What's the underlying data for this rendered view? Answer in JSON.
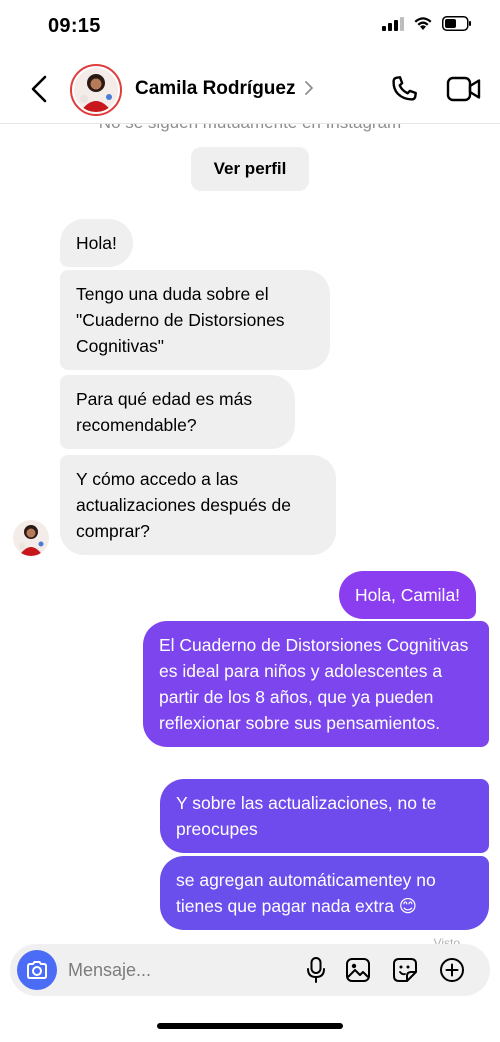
{
  "status_bar": {
    "time": "09:15"
  },
  "header": {
    "contact_name": "Camila Rodríguez"
  },
  "chat": {
    "faded_notice": "No se siguen mutuamente en Instagram",
    "view_profile_label": "Ver perfil",
    "incoming": [
      "Hola!",
      "Tengo una duda sobre el \"Cuaderno de Distorsiones Cognitivas\"",
      "Para qué edad es más recomendable?",
      "Y cómo accedo a las actualizaciones después de comprar?"
    ],
    "outgoing": [
      "Hola, Camila!",
      "El Cuaderno de Distorsiones Cognitivas es ideal para niños y adolescentes a partir de los 8 años, que ya pueden reflexionar sobre sus pensamientos.",
      "Y sobre las actualizaciones, no te preocupes",
      "se agregan automáticamentey no tienes que pagar nada extra 😊"
    ],
    "seen_label": "Visto"
  },
  "composer": {
    "placeholder": "Mensaje..."
  },
  "colors": {
    "accent_blue": "#4a6cf7",
    "bubble_gradient_top": "#8b3ef0",
    "bubble_gradient_bottom": "#6a4fec",
    "incoming_bubble": "#efefef",
    "avatar_ring": "#e13c3c"
  },
  "icons": [
    "back-arrow-icon",
    "chevron-right-icon",
    "phone-icon",
    "video-camera-icon",
    "camera-icon",
    "microphone-icon",
    "gallery-icon",
    "sticker-icon",
    "plus-circle-icon",
    "signal-icon",
    "wifi-icon",
    "battery-icon"
  ]
}
